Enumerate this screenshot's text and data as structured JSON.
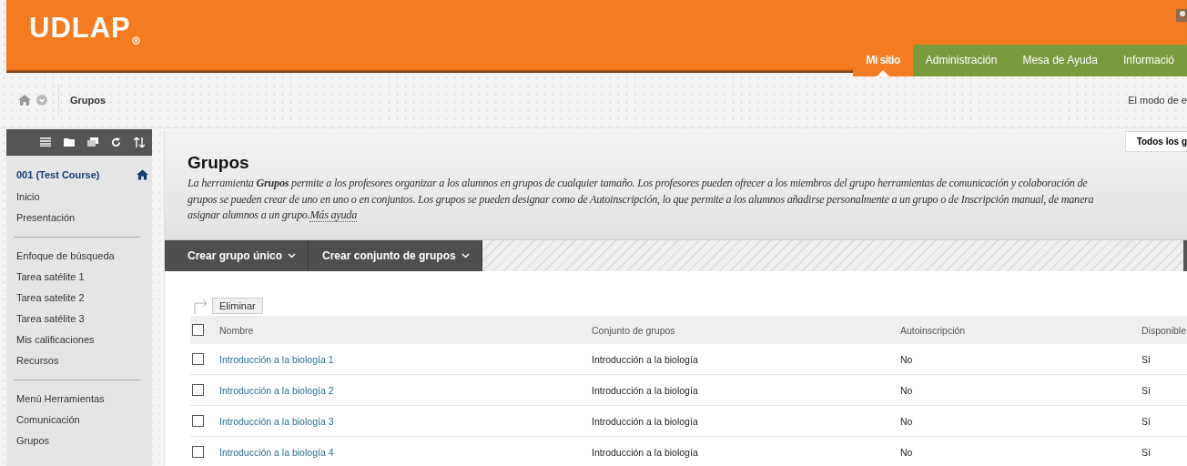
{
  "header": {
    "logo": "UDLAP",
    "tabs": [
      {
        "label": "Mi sitio",
        "selected": true
      },
      {
        "label": "Administración",
        "selected": false
      },
      {
        "label": "Mesa de Ayuda",
        "selected": false
      },
      {
        "label": "Informació",
        "selected": false
      }
    ]
  },
  "breadcrumb": {
    "current": "Grupos",
    "edit_mode": "El modo de e"
  },
  "sidebar": {
    "course": "001 (Test Course)",
    "sections": [
      [
        "Inicio",
        "Presentación"
      ],
      [
        "Enfoque de búsqueda",
        "Tarea satélite 1",
        "Tarea satelite 2",
        "Tarea satélite 3",
        "Mis calificaciones",
        "Recursos"
      ],
      [
        "Menú Herramientas",
        "Comunicación",
        "Grupos"
      ]
    ]
  },
  "page": {
    "title": "Grupos",
    "view_tab": "Todos los g",
    "description": [
      "La herramienta **Grupos** permite a los profesores organizar a los alumnos en grupos de cualquier tamaño. Los profesores pueden ofrecer a los miembros del grupo herramientas de comunicación y colaboración de",
      "grupos se pueden crear de uno en uno o en conjuntos. Los grupos se pueden designar como de Autoinscripción, lo que permite a los alumnos añadirse personalmente a un grupo o de Inscripción manual, de manera",
      "asignar alumnos a un grupo."
    ],
    "help_link": "Más ayuda",
    "actions": [
      "Crear grupo único",
      "Crear conjunto de grupos"
    ]
  },
  "table": {
    "delete_button": "Eliminar",
    "select_all": {
      "checked": false
    },
    "columns": [
      "Nombre",
      "Conjunto de grupos",
      "Autoinscripción",
      "Disponible"
    ],
    "rows": [
      {
        "checked": false,
        "cells": [
          "Introducción a la biología 1",
          "Introducción a la biología",
          "No",
          "Sí"
        ]
      },
      {
        "checked": false,
        "cells": [
          "Introducción a la biología 2",
          "Introducción a la biología",
          "No",
          "Sí"
        ]
      },
      {
        "checked": false,
        "cells": [
          "Introducción a la biología 3",
          "Introducción a la biología",
          "No",
          "Sí"
        ]
      },
      {
        "checked": false,
        "cells": [
          "Introducción a la biología 4",
          "Introducción a la biología",
          "No",
          "Sí"
        ]
      }
    ]
  }
}
